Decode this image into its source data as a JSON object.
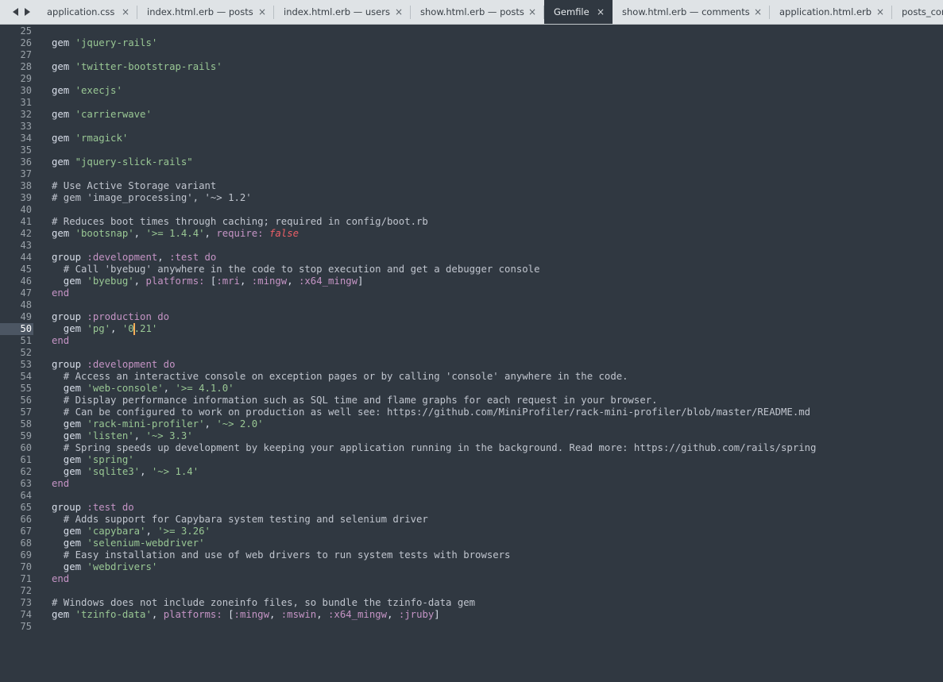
{
  "tabs": [
    {
      "label": "application.css",
      "active": false
    },
    {
      "label": "index.html.erb — posts",
      "active": false
    },
    {
      "label": "index.html.erb — users",
      "active": false
    },
    {
      "label": "show.html.erb — posts",
      "active": false
    },
    {
      "label": "Gemfile",
      "active": true
    },
    {
      "label": "show.html.erb — comments",
      "active": false
    },
    {
      "label": "application.html.erb",
      "active": false
    },
    {
      "label": "posts_con",
      "active": false
    }
  ],
  "tab_close_glyph": "×",
  "nav_icons": [
    "arrow-left-icon",
    "arrow-right-icon"
  ],
  "colors": {
    "background": "#303841",
    "string": "#99c794",
    "symbol": "#c594c5",
    "constant": "#ec5f67",
    "caret": "#f9ae58",
    "current_line_number": "#4c5663"
  },
  "editor": {
    "first_line": 25,
    "current_line": 50,
    "lines": [
      [],
      [
        {
          "t": "gem ",
          "c": "default"
        },
        {
          "t": "'jquery-rails'",
          "c": "string"
        }
      ],
      [],
      [
        {
          "t": "gem ",
          "c": "default"
        },
        {
          "t": "'twitter-bootstrap-rails'",
          "c": "string"
        }
      ],
      [],
      [
        {
          "t": "gem ",
          "c": "default"
        },
        {
          "t": "'execjs'",
          "c": "string"
        }
      ],
      [],
      [
        {
          "t": "gem ",
          "c": "default"
        },
        {
          "t": "'carrierwave'",
          "c": "string"
        }
      ],
      [],
      [
        {
          "t": "gem ",
          "c": "default"
        },
        {
          "t": "'rmagick'",
          "c": "string"
        }
      ],
      [],
      [
        {
          "t": "gem ",
          "c": "default"
        },
        {
          "t": "\"jquery-slick-rails\"",
          "c": "string"
        }
      ],
      [],
      [
        {
          "t": "# Use Active Storage variant",
          "c": "comment"
        }
      ],
      [
        {
          "t": "# gem 'image_processing', '~> 1.2'",
          "c": "comment"
        }
      ],
      [],
      [
        {
          "t": "# Reduces boot times through caching; required in config/boot.rb",
          "c": "comment"
        }
      ],
      [
        {
          "t": "gem ",
          "c": "default"
        },
        {
          "t": "'bootsnap'",
          "c": "string"
        },
        {
          "t": ", ",
          "c": "default"
        },
        {
          "t": "'>= 1.4.4'",
          "c": "string"
        },
        {
          "t": ", ",
          "c": "default"
        },
        {
          "t": "require:",
          "c": "symbol"
        },
        {
          "t": " ",
          "c": "default"
        },
        {
          "t": "false",
          "c": "constant"
        }
      ],
      [],
      [
        {
          "t": "group ",
          "c": "default"
        },
        {
          "t": ":development",
          "c": "symbol"
        },
        {
          "t": ", ",
          "c": "default"
        },
        {
          "t": ":test",
          "c": "symbol"
        },
        {
          "t": " do",
          "c": "symbol"
        }
      ],
      [
        {
          "t": "  # Call 'byebug' anywhere in the code to stop execution and get a debugger console",
          "c": "comment"
        }
      ],
      [
        {
          "t": "  gem ",
          "c": "default"
        },
        {
          "t": "'byebug'",
          "c": "string"
        },
        {
          "t": ", ",
          "c": "default"
        },
        {
          "t": "platforms:",
          "c": "symbol"
        },
        {
          "t": " [",
          "c": "default"
        },
        {
          "t": ":mri",
          "c": "symbol"
        },
        {
          "t": ", ",
          "c": "default"
        },
        {
          "t": ":mingw",
          "c": "symbol"
        },
        {
          "t": ", ",
          "c": "default"
        },
        {
          "t": ":x64_mingw",
          "c": "symbol"
        },
        {
          "t": "]",
          "c": "default"
        }
      ],
      [
        {
          "t": "end",
          "c": "symbol"
        }
      ],
      [],
      [
        {
          "t": "group ",
          "c": "default"
        },
        {
          "t": ":production",
          "c": "symbol"
        },
        {
          "t": " do",
          "c": "symbol"
        }
      ],
      [
        {
          "t": "  gem ",
          "c": "default"
        },
        {
          "t": "'pg'",
          "c": "string"
        },
        {
          "t": ", ",
          "c": "default"
        },
        {
          "t": "'0.21'",
          "c": "string"
        }
      ],
      [
        {
          "t": "end",
          "c": "symbol"
        }
      ],
      [],
      [
        {
          "t": "group ",
          "c": "default"
        },
        {
          "t": ":development",
          "c": "symbol"
        },
        {
          "t": " do",
          "c": "symbol"
        }
      ],
      [
        {
          "t": "  # Access an interactive console on exception pages or by calling 'console' anywhere in the code.",
          "c": "comment"
        }
      ],
      [
        {
          "t": "  gem ",
          "c": "default"
        },
        {
          "t": "'web-console'",
          "c": "string"
        },
        {
          "t": ", ",
          "c": "default"
        },
        {
          "t": "'>= 4.1.0'",
          "c": "string"
        }
      ],
      [
        {
          "t": "  # Display performance information such as SQL time and flame graphs for each request in your browser.",
          "c": "comment"
        }
      ],
      [
        {
          "t": "  # Can be configured to work on production as well see: https://github.com/MiniProfiler/rack-mini-profiler/blob/master/README.md",
          "c": "comment"
        }
      ],
      [
        {
          "t": "  gem ",
          "c": "default"
        },
        {
          "t": "'rack-mini-profiler'",
          "c": "string"
        },
        {
          "t": ", ",
          "c": "default"
        },
        {
          "t": "'~> 2.0'",
          "c": "string"
        }
      ],
      [
        {
          "t": "  gem ",
          "c": "default"
        },
        {
          "t": "'listen'",
          "c": "string"
        },
        {
          "t": ", ",
          "c": "default"
        },
        {
          "t": "'~> 3.3'",
          "c": "string"
        }
      ],
      [
        {
          "t": "  # Spring speeds up development by keeping your application running in the background. Read more: https://github.com/rails/spring",
          "c": "comment"
        }
      ],
      [
        {
          "t": "  gem ",
          "c": "default"
        },
        {
          "t": "'spring'",
          "c": "string"
        }
      ],
      [
        {
          "t": "  gem ",
          "c": "default"
        },
        {
          "t": "'sqlite3'",
          "c": "string"
        },
        {
          "t": ", ",
          "c": "default"
        },
        {
          "t": "'~> 1.4'",
          "c": "string"
        }
      ],
      [
        {
          "t": "end",
          "c": "symbol"
        }
      ],
      [],
      [
        {
          "t": "group ",
          "c": "default"
        },
        {
          "t": ":test",
          "c": "symbol"
        },
        {
          "t": " do",
          "c": "symbol"
        }
      ],
      [
        {
          "t": "  # Adds support for Capybara system testing and selenium driver",
          "c": "comment"
        }
      ],
      [
        {
          "t": "  gem ",
          "c": "default"
        },
        {
          "t": "'capybara'",
          "c": "string"
        },
        {
          "t": ", ",
          "c": "default"
        },
        {
          "t": "'>= 3.26'",
          "c": "string"
        }
      ],
      [
        {
          "t": "  gem ",
          "c": "default"
        },
        {
          "t": "'selenium-webdriver'",
          "c": "string"
        }
      ],
      [
        {
          "t": "  # Easy installation and use of web drivers to run system tests with browsers",
          "c": "comment"
        }
      ],
      [
        {
          "t": "  gem ",
          "c": "default"
        },
        {
          "t": "'webdrivers'",
          "c": "string"
        }
      ],
      [
        {
          "t": "end",
          "c": "symbol"
        }
      ],
      [],
      [
        {
          "t": "# Windows does not include zoneinfo files, so bundle the tzinfo-data gem",
          "c": "comment"
        }
      ],
      [
        {
          "t": "gem ",
          "c": "default"
        },
        {
          "t": "'tzinfo-data'",
          "c": "string"
        },
        {
          "t": ", ",
          "c": "default"
        },
        {
          "t": "platforms:",
          "c": "symbol"
        },
        {
          "t": " [",
          "c": "default"
        },
        {
          "t": ":mingw",
          "c": "symbol"
        },
        {
          "t": ", ",
          "c": "default"
        },
        {
          "t": ":mswin",
          "c": "symbol"
        },
        {
          "t": ", ",
          "c": "default"
        },
        {
          "t": ":x64_mingw",
          "c": "symbol"
        },
        {
          "t": ", ",
          "c": "default"
        },
        {
          "t": ":jruby",
          "c": "symbol"
        },
        {
          "t": "]",
          "c": "default"
        }
      ],
      []
    ]
  }
}
